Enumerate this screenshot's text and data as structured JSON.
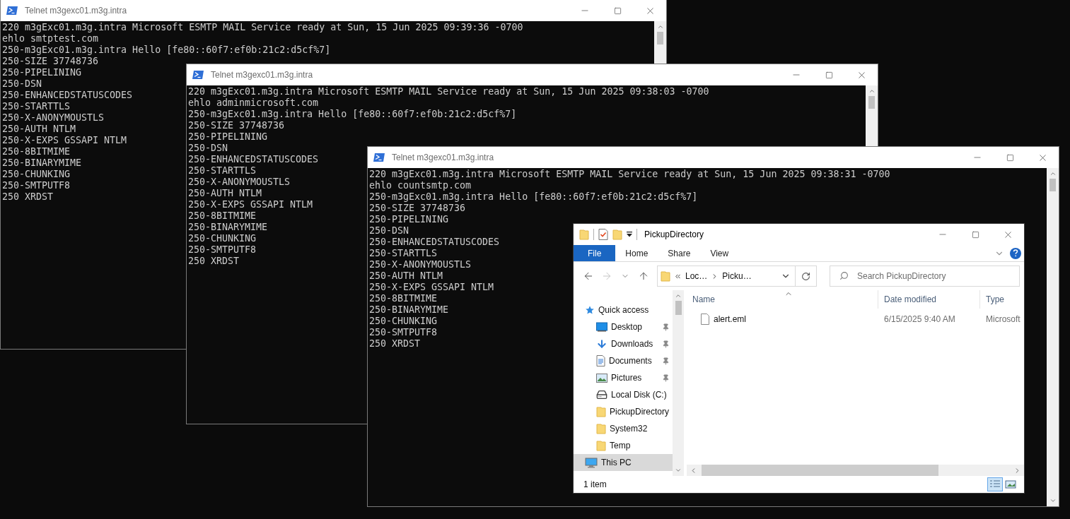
{
  "terminal_windows": [
    {
      "title": "Telnet m3gexc01.m3g.intra",
      "lines": [
        "220 m3gExc01.m3g.intra Microsoft ESMTP MAIL Service ready at Sun, 15 Jun 2025 09:39:36 -0700",
        "ehlo smtptest.com",
        "250-m3gExc01.m3g.intra Hello [fe80::60f7:ef0b:21c2:d5cf%7]",
        "250-SIZE 37748736",
        "250-PIPELINING",
        "250-DSN",
        "250-ENHANCEDSTATUSCODES",
        "250-STARTTLS",
        "250-X-ANONYMOUSTLS",
        "250-AUTH NTLM",
        "250-X-EXPS GSSAPI NTLM",
        "250-8BITMIME",
        "250-BINARYMIME",
        "250-CHUNKING",
        "250-SMTPUTF8",
        "250 XRDST"
      ]
    },
    {
      "title": "Telnet m3gexc01.m3g.intra",
      "lines": [
        "220 m3gExc01.m3g.intra Microsoft ESMTP MAIL Service ready at Sun, 15 Jun 2025 09:38:03 -0700",
        "ehlo adminmicrosoft.com",
        "250-m3gExc01.m3g.intra Hello [fe80::60f7:ef0b:21c2:d5cf%7]",
        "250-SIZE 37748736",
        "250-PIPELINING",
        "250-DSN",
        "250-ENHANCEDSTATUSCODES",
        "250-STARTTLS",
        "250-X-ANONYMOUSTLS",
        "250-AUTH NTLM",
        "250-X-EXPS GSSAPI NTLM",
        "250-8BITMIME",
        "250-BINARYMIME",
        "250-CHUNKING",
        "250-SMTPUTF8",
        "250 XRDST"
      ]
    },
    {
      "title": "Telnet m3gexc01.m3g.intra",
      "lines": [
        "220 m3gExc01.m3g.intra Microsoft ESMTP MAIL Service ready at Sun, 15 Jun 2025 09:38:31 -0700",
        "ehlo countsmtp.com",
        "250-m3gExc01.m3g.intra Hello [fe80::60f7:ef0b:21c2:d5cf%7]",
        "250-SIZE 37748736",
        "250-PIPELINING",
        "250-DSN",
        "250-ENHANCEDSTATUSCODES",
        "250-STARTTLS",
        "250-X-ANONYMOUSTLS",
        "250-AUTH NTLM",
        "250-X-EXPS GSSAPI NTLM",
        "250-8BITMIME",
        "250-BINARYMIME",
        "250-CHUNKING",
        "250-SMTPUTF8",
        "250 XRDST"
      ]
    }
  ],
  "explorer_window": {
    "title": "PickupDirectory",
    "ribbon_tabs": [
      {
        "label": "File",
        "kind": "menu"
      },
      {
        "label": "Home",
        "kind": "tab"
      },
      {
        "label": "Share",
        "kind": "tab"
      },
      {
        "label": "View",
        "kind": "tab"
      }
    ],
    "nav_buttons": [
      {
        "kind": "back",
        "disabled": false
      },
      {
        "kind": "forward",
        "disabled": true
      },
      {
        "kind": "recent",
        "disabled": false
      },
      {
        "kind": "up",
        "disabled": false
      }
    ],
    "address": {
      "segments": [
        "Loc…",
        "Picku…"
      ]
    },
    "search": {
      "placeholder": "Search PickupDirectory"
    },
    "sidebar": [
      {
        "label": "Quick access",
        "kind": "quick-access",
        "pinned": false,
        "selected": false
      },
      {
        "label": "Desktop",
        "kind": "desktop",
        "pinned": true,
        "selected": false
      },
      {
        "label": "Downloads",
        "kind": "downloads",
        "pinned": true,
        "selected": false
      },
      {
        "label": "Documents",
        "kind": "documents",
        "pinned": true,
        "selected": false
      },
      {
        "label": "Pictures",
        "kind": "pictures",
        "pinned": true,
        "selected": false
      },
      {
        "label": "Local Disk (C:)",
        "kind": "disk",
        "pinned": false,
        "selected": false
      },
      {
        "label": "PickupDirectory",
        "kind": "folder",
        "pinned": false,
        "selected": false
      },
      {
        "label": "System32",
        "kind": "folder",
        "pinned": false,
        "selected": false
      },
      {
        "label": "Temp",
        "kind": "folder",
        "pinned": false,
        "selected": false
      },
      {
        "label": "This PC",
        "kind": "pc",
        "pinned": false,
        "selected": true
      }
    ],
    "columns": [
      "Name",
      "Date modified",
      "Type"
    ],
    "files": [
      {
        "name": "alert.eml",
        "date_modified": "6/15/2025 9:40 AM",
        "type": "Microsoft"
      }
    ],
    "status": "1 item",
    "views": [
      {
        "kind": "details",
        "selected": true
      },
      {
        "kind": "large-icons",
        "selected": false
      }
    ]
  }
}
